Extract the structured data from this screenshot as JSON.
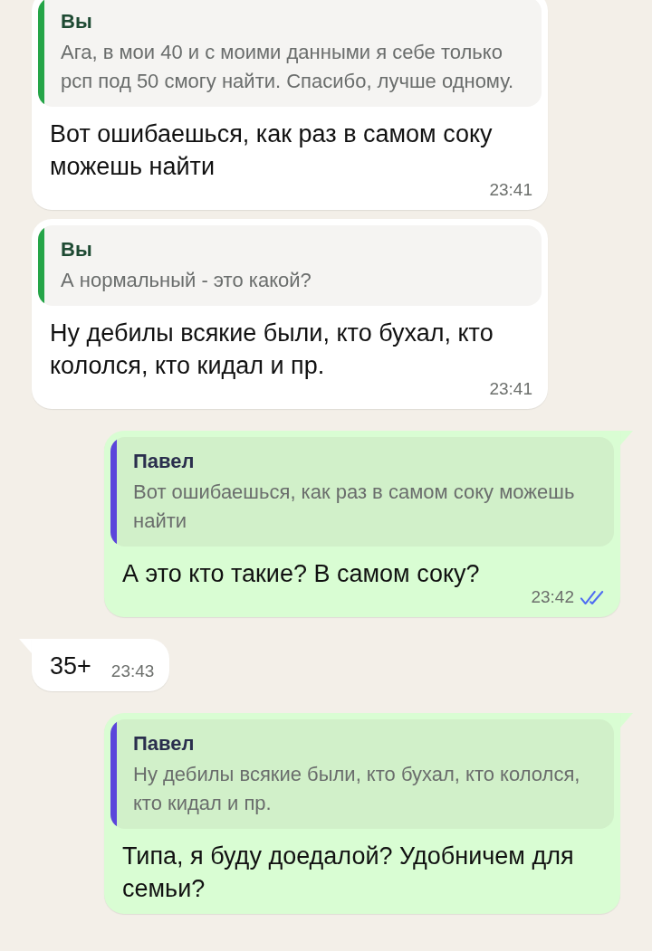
{
  "messages": [
    {
      "outgoing": false,
      "tail": false,
      "reply": {
        "author": "Вы",
        "color": "#25a548",
        "text": "Ага, в мои 40 и с моими данными я себе только рсп под 50 смогу найти. Спасибо, лучше одному."
      },
      "text": "Вот ошибаешься, как раз в самом соку можешь найти",
      "time": "23:41"
    },
    {
      "outgoing": false,
      "tail": false,
      "reply": {
        "author": "Вы",
        "color": "#25a548",
        "text": "А нормальный - это какой?"
      },
      "text": "Ну дебилы всякие были, кто бухал, кто кололся, кто кидал и пр.",
      "time": "23:41"
    },
    {
      "outgoing": true,
      "tail": true,
      "reply": {
        "author": "Павел",
        "color": "#5b45db",
        "text": "Вот ошибаешься, как раз в самом соку можешь найти"
      },
      "text": "А это кто такие? В самом соку?",
      "time": "23:42",
      "read": true
    },
    {
      "outgoing": false,
      "tail": true,
      "text": "35+",
      "time": "23:43"
    },
    {
      "outgoing": true,
      "tail": true,
      "reply": {
        "author": "Павел",
        "color": "#5b45db",
        "text": "Ну дебилы всякие были, кто бухал, кто кололся, кто кидал и пр."
      },
      "text": "Типа, я буду доедалой? Удобничем для семьи?"
    }
  ]
}
